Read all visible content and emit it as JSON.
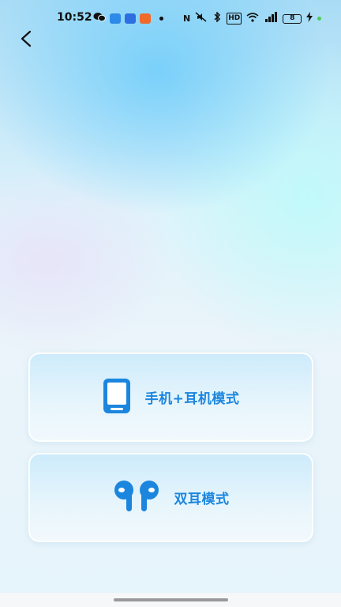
{
  "status_bar": {
    "time": "10:52",
    "battery_level": "8",
    "network_label": "HD"
  },
  "modes": [
    {
      "label": "手机+耳机模式",
      "icon": "phone-icon"
    },
    {
      "label": "双耳模式",
      "icon": "earbuds-icon"
    }
  ],
  "colors": {
    "accent": "#1c86de",
    "card_top": "#cdebfb",
    "card_bottom": "#f2f9fd"
  }
}
